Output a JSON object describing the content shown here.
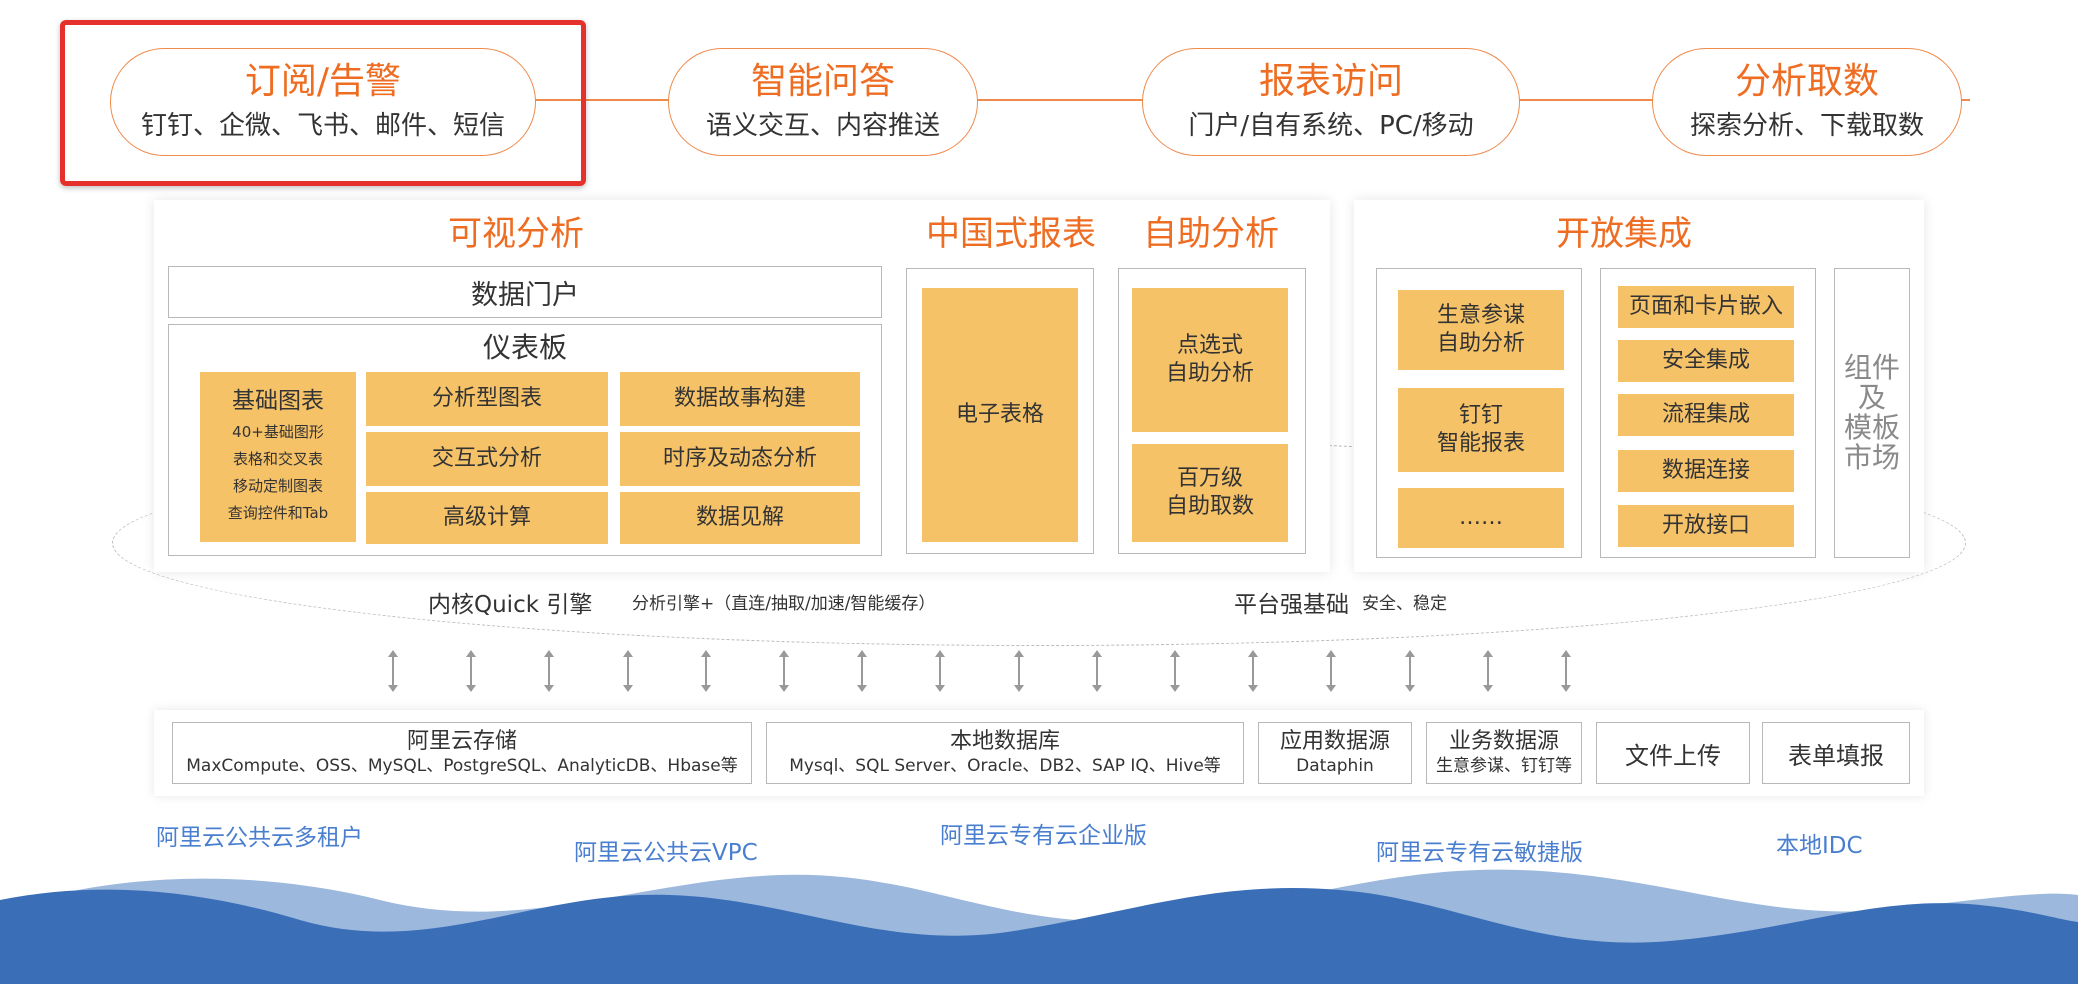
{
  "top_capabilities": [
    {
      "title": "订阅/告警",
      "subtitle": "钉钉、企微、飞书、邮件、短信"
    },
    {
      "title": "智能问答",
      "subtitle": "语义交互、内容推送"
    },
    {
      "title": "报表访问",
      "subtitle": "门户/自有系统、PC/移动"
    },
    {
      "title": "分析取数",
      "subtitle": "探索分析、下载取数"
    }
  ],
  "visual_analysis": {
    "title": "可视分析",
    "portal": "数据门户",
    "dashboard": "仪表板",
    "basic_charts": {
      "title": "基础图表",
      "lines": [
        "40+基础图形",
        "表格和交叉表",
        "移动定制图表",
        "查询控件和Tab"
      ]
    },
    "middle_col": [
      "分析型图表",
      "交互式分析",
      "高级计算"
    ],
    "right_col": [
      "数据故事构建",
      "时序及动态分析",
      "数据见解"
    ]
  },
  "china_report": {
    "title": "中国式报表",
    "item": "电子表格"
  },
  "self_service": {
    "title": "自助分析",
    "items": [
      "点选式\n自助分析",
      "百万级\n自助取数"
    ]
  },
  "open_integration": {
    "title": "开放集成",
    "col1": [
      "生意参谋\n自助分析",
      "钉钉\n智能报表",
      "……"
    ],
    "col2": [
      "页面和卡片嵌入",
      "安全集成",
      "流程集成",
      "数据连接",
      "开放接口"
    ],
    "market": "组件\n及\n模板\n市场"
  },
  "engine": {
    "core_label": "内核Quick 引擎",
    "core_desc": "分析引擎+（直连/抽取/加速/智能缓存）",
    "platform_label": "平台强基础",
    "platform_desc": "安全、稳定"
  },
  "data_sources": [
    {
      "title": "阿里云存储",
      "sub": "MaxCompute、OSS、MySQL、PostgreSQL、AnalyticDB、Hbase等"
    },
    {
      "title": "本地数据库",
      "sub": "Mysql、SQL Server、Oracle、DB2、SAP IQ、Hive等"
    },
    {
      "title": "应用数据源",
      "sub": "Dataphin"
    },
    {
      "title": "业务数据源",
      "sub": "生意参谋、钉钉等"
    },
    {
      "title": "文件上传"
    },
    {
      "title": "表单填报"
    }
  ],
  "deployments": [
    "阿里云公共云多租户",
    "阿里云公共云VPC",
    "阿里云专有云企业版",
    "阿里云专有云敏捷版",
    "本地IDC"
  ],
  "colors": {
    "accent": "#ee6d22",
    "box": "#f5c268",
    "highlight": "#e5312b",
    "deploy_text": "#4a7fd0",
    "wave_dark": "#3a6fb8",
    "wave_light": "#9cb8dd"
  }
}
